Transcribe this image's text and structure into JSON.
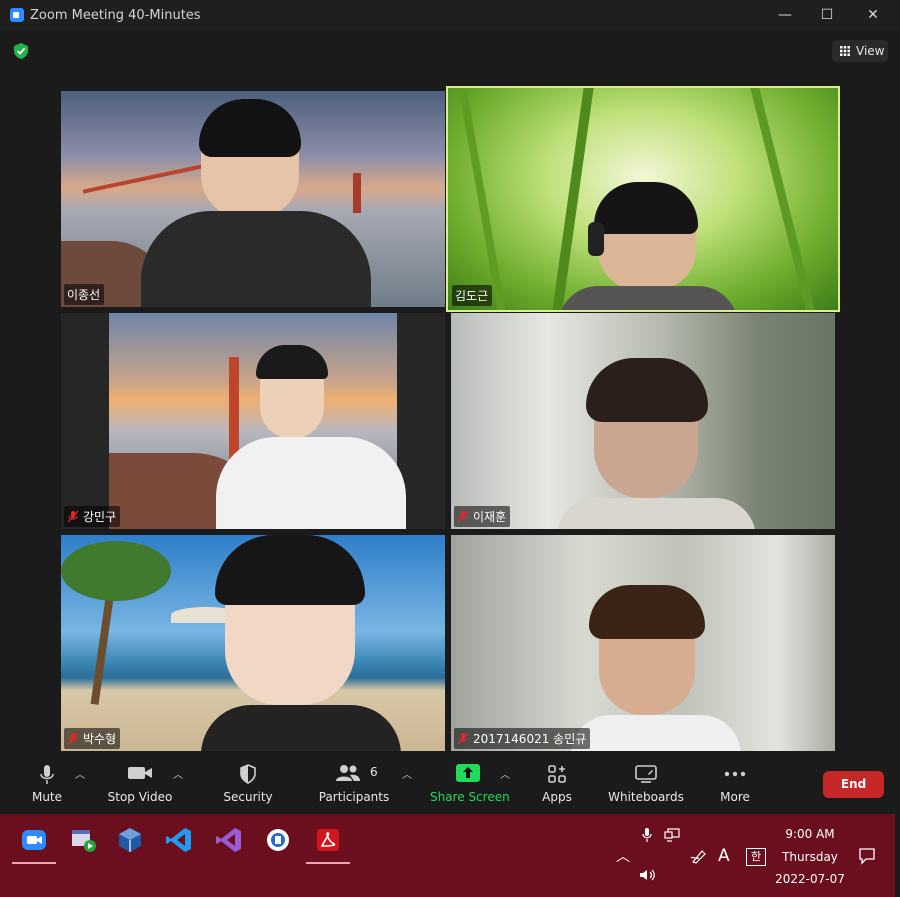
{
  "window": {
    "title": "Zoom Meeting 40-Minutes",
    "controls": [
      "—",
      "☐",
      "✕"
    ]
  },
  "header": {
    "view_label": "View"
  },
  "participants": [
    {
      "name": "이종선",
      "muted": false,
      "active": false,
      "background": "golden-gate-bridge"
    },
    {
      "name": "김도근",
      "muted": false,
      "active": true,
      "background": "green-grass"
    },
    {
      "name": "강민구",
      "muted": true,
      "active": false,
      "background": "golden-gate-bridge"
    },
    {
      "name": "이재훈",
      "muted": true,
      "active": false,
      "background": "blurred"
    },
    {
      "name": "박수형",
      "muted": true,
      "active": false,
      "background": "tropical-beach"
    },
    {
      "name": "2017146021 송민규",
      "muted": true,
      "active": false,
      "background": "blurred"
    }
  ],
  "toolbar": {
    "mute": "Mute",
    "stop_video": "Stop Video",
    "security": "Security",
    "participants": "Participants",
    "participants_count": "6",
    "share_screen": "Share Screen",
    "apps": "Apps",
    "whiteboards": "Whiteboards",
    "more": "More",
    "end": "End"
  },
  "taskbar": {
    "apps": [
      "zoom-icon",
      "sandbox-icon",
      "virtualbox-icon",
      "vscode-icon",
      "visual-studio-icon",
      "hwp-icon",
      "acrobat-icon"
    ],
    "time": "9:00 AM",
    "day": "Thursday",
    "date": "2022-07-07",
    "ime_a": "A",
    "ime_hangul": "한"
  },
  "colors": {
    "active_speaker_border": "#d9ef8c",
    "share_green": "#23d959",
    "end_red": "#c62828",
    "taskbar_bg": "#6b0f1e",
    "zoom_blue": "#2d8cff"
  }
}
